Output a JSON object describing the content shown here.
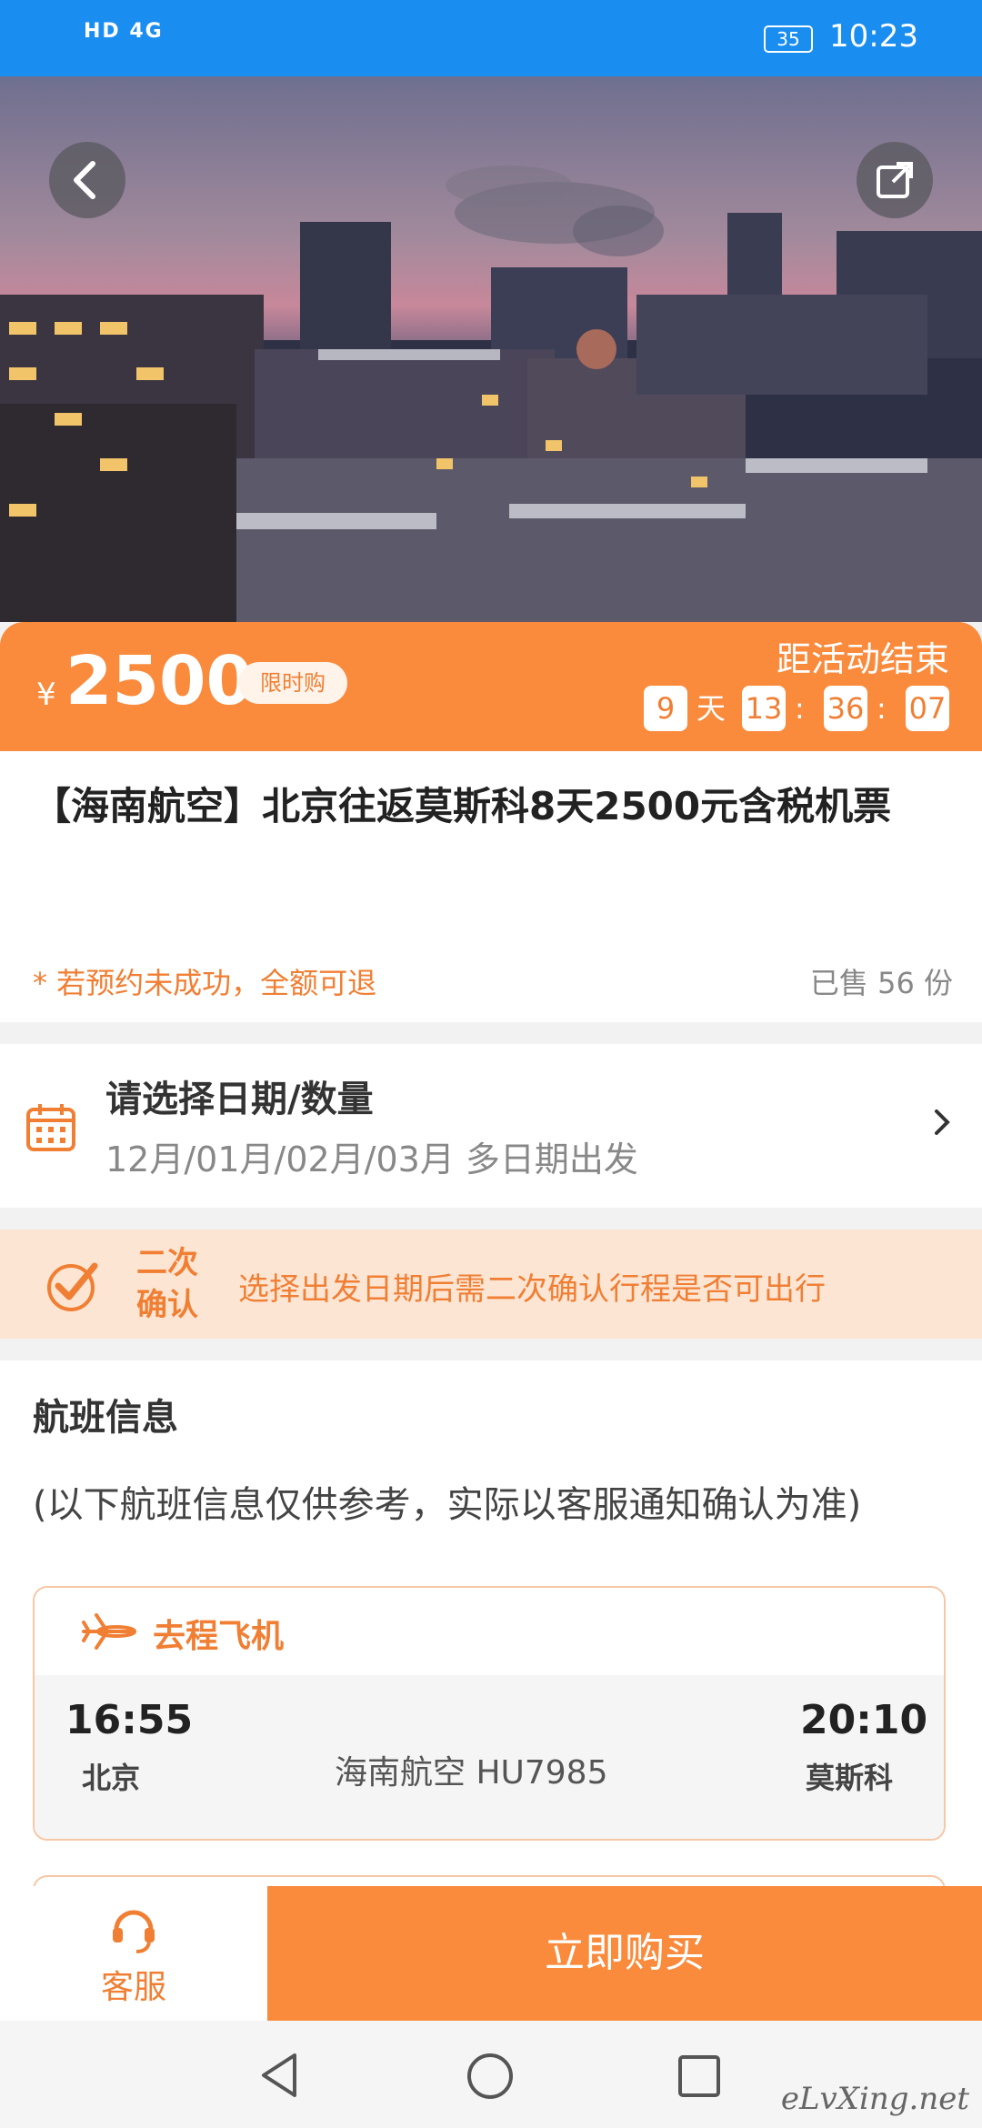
{
  "status_bar": {
    "network": "HD 4G",
    "battery": "35",
    "time": "10:23"
  },
  "price_band": {
    "currency": "¥",
    "price": "2500",
    "tag": "限时购",
    "countdown_label": "距活动结束",
    "days": "9",
    "days_unit": "天",
    "hours": "13",
    "minutes": "36",
    "seconds": "07",
    "sep": ":"
  },
  "product": {
    "title": "【海南航空】北京往返莫斯科8天2500元含税机票",
    "refund_note": "* 若预约未成功，全额可退",
    "sold": "已售 56 份"
  },
  "date_select": {
    "title": "请选择日期/数量",
    "subtitle": "12月/01月/02月/03月 多日期出发"
  },
  "confirm_notice": {
    "tag": "二次确认",
    "text": "选择出发日期后需二次确认行程是否可出行"
  },
  "flight_info": {
    "heading": "航班信息",
    "note": "(以下航班信息仅供参考，实际以客服通知确认为准)",
    "outbound": {
      "label": "去程飞机",
      "depart_time": "16:55",
      "depart_city": "北京",
      "airline_flight": "海南航空  HU7985",
      "arrive_time": "20:10",
      "arrive_city": "莫斯科"
    }
  },
  "bottom_bar": {
    "service_label": "客服",
    "buy_label": "立即购买"
  },
  "watermark": "eLvXing.net",
  "colors": {
    "accent": "#fa8a3c",
    "status_bar": "#1a8ef0"
  },
  "icons": [
    "back-icon",
    "share-icon",
    "calendar-icon",
    "chevron-right-icon",
    "check-icon",
    "plane-icon",
    "headset-icon",
    "nav-back-icon",
    "nav-home-icon",
    "nav-recents-icon"
  ]
}
